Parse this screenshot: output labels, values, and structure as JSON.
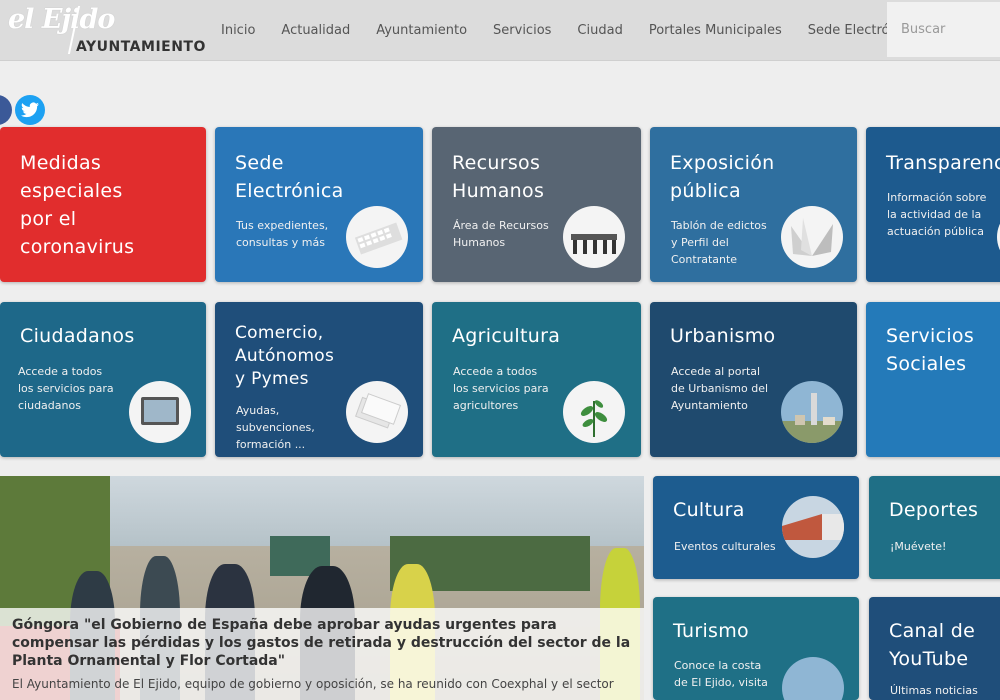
{
  "header": {
    "logo_script": "el Ejido",
    "logo_word": "AYUNTAMIENTO",
    "menu": [
      "Inicio",
      "Actualidad",
      "Ayuntamiento",
      "Servicios",
      "Ciudad",
      "Portales Municipales",
      "Sede Electrónica"
    ],
    "search_placeholder": "Buscar"
  },
  "social": {
    "facebook": "facebook-icon",
    "twitter": "twitter-icon"
  },
  "cards": {
    "coronavirus": {
      "title": "Medidas\nespeciales\npor el\ncoronavirus"
    },
    "sede": {
      "title": "Sede\nElectrónica",
      "desc": "Tus expedientes,\nconsultas y más"
    },
    "rrhh": {
      "title": "Recursos\nHumanos",
      "desc": "Área de Recursos\nHumanos"
    },
    "exposicion": {
      "title": "Exposición\npública",
      "desc": "Tablón de edictos\ny Perfil del\nContratante"
    },
    "transparencia": {
      "title": "Transparencia",
      "desc": "Información sobre\nla actividad de la\nactuación pública"
    },
    "ciudadanos": {
      "title": "Ciudadanos",
      "desc": "Accede a todos\nlos servicios para\nciudadanos"
    },
    "comercio": {
      "title": "Comercio,\nAutónomos\ny Pymes",
      "desc": "Ayudas,\nsubvenciones,\nformación ..."
    },
    "agricultura": {
      "title": "Agricultura",
      "desc": "Accede a todos\nlos servicios para\nagricultores"
    },
    "urbanismo": {
      "title": "Urbanismo",
      "desc": "Accede al portal\nde Urbanismo del\nAyuntamiento"
    },
    "sociales": {
      "title": "Servicios\nSociales"
    },
    "cultura": {
      "title": "Cultura",
      "desc": "Eventos culturales"
    },
    "deportes": {
      "title": "Deportes",
      "desc": "¡Muévete!"
    },
    "turismo": {
      "title": "Turismo",
      "desc": "Conoce la costa\nde El Ejido, visita"
    },
    "youtube": {
      "title": "Canal de\nYouTube",
      "desc": "Últimas noticias"
    }
  },
  "news": {
    "headline": "Góngora \"el Gobierno de España debe aprobar ayudas urgentes para compensar las pérdidas y los gastos de retirada y destrucción del sector de la Planta Ornamental y Flor Cortada\"",
    "lead": "El Ayuntamiento de El Ejido, equipo de gobierno y oposición, se ha reunido con Coexphal y el sector"
  }
}
